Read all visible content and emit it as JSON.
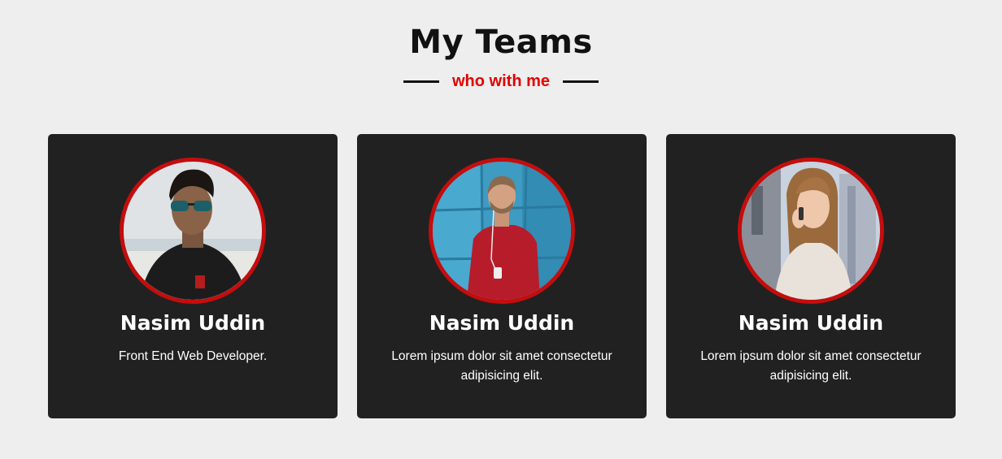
{
  "header": {
    "title": "My Teams",
    "subtitle": "who with me"
  },
  "colors": {
    "background": "#eeeeee",
    "card": "#212121",
    "accent": "#e40000",
    "avatar_border": "#c40d0d"
  },
  "team": [
    {
      "name": "Nasim Uddin",
      "description": "Front End Web Developer.",
      "photo": "young man with sunglasses in black polo shirt at beach"
    },
    {
      "name": "Nasim Uddin",
      "description": "Lorem ipsum dolor sit amet consectetur adipisicing elit.",
      "photo": "smiling man in red sweater with earphones against blue wall"
    },
    {
      "name": "Nasim Uddin",
      "description": "Lorem ipsum dolor sit amet consectetur adipisicing elit.",
      "photo": "smiling woman on phone in white jacket in city"
    }
  ]
}
